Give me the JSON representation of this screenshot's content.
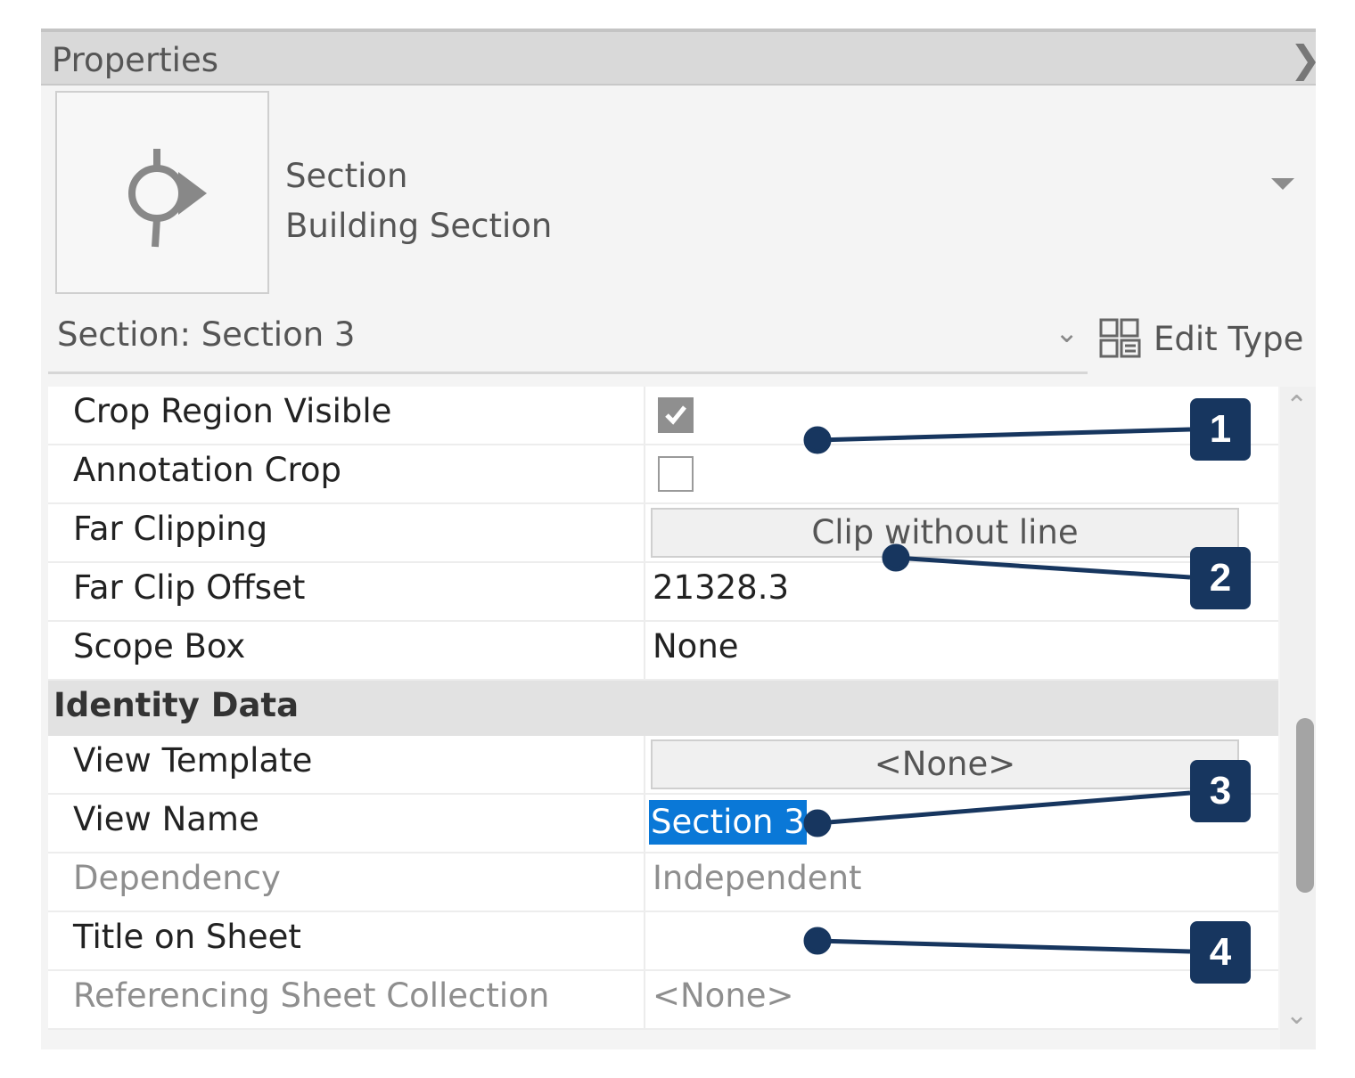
{
  "panel": {
    "title": "Properties",
    "close_icon": "close-icon"
  },
  "type_selector": {
    "category": "Section",
    "type": "Building Section",
    "icon": "section-marker-icon"
  },
  "instance": {
    "label": "Section: Section 3",
    "edit_type_label": "Edit Type"
  },
  "properties": [
    {
      "name": "Crop Region Visible",
      "kind": "checkbox",
      "checked": true
    },
    {
      "name": "Annotation Crop",
      "kind": "checkbox",
      "checked": false
    },
    {
      "name": "Far Clipping",
      "kind": "button",
      "value": "Clip without line"
    },
    {
      "name": "Far Clip Offset",
      "kind": "text",
      "value": "21328.3"
    },
    {
      "name": "Scope Box",
      "kind": "text",
      "value": "None"
    }
  ],
  "group": {
    "name": "Identity Data"
  },
  "identity_properties": [
    {
      "name": "View Template",
      "kind": "button",
      "value": "<None>"
    },
    {
      "name": "View Name",
      "kind": "selected",
      "value": "Section 3"
    },
    {
      "name": "Dependency",
      "kind": "text",
      "value": "Independent",
      "dim": true
    },
    {
      "name": "Title on Sheet",
      "kind": "text",
      "value": ""
    },
    {
      "name": "Referencing Sheet Collection",
      "kind": "text",
      "value": "<None>",
      "dim": true
    }
  ],
  "callouts": [
    "1",
    "2",
    "3",
    "4"
  ],
  "colors": {
    "callout": "#17365f",
    "selection": "#0a78d7"
  }
}
